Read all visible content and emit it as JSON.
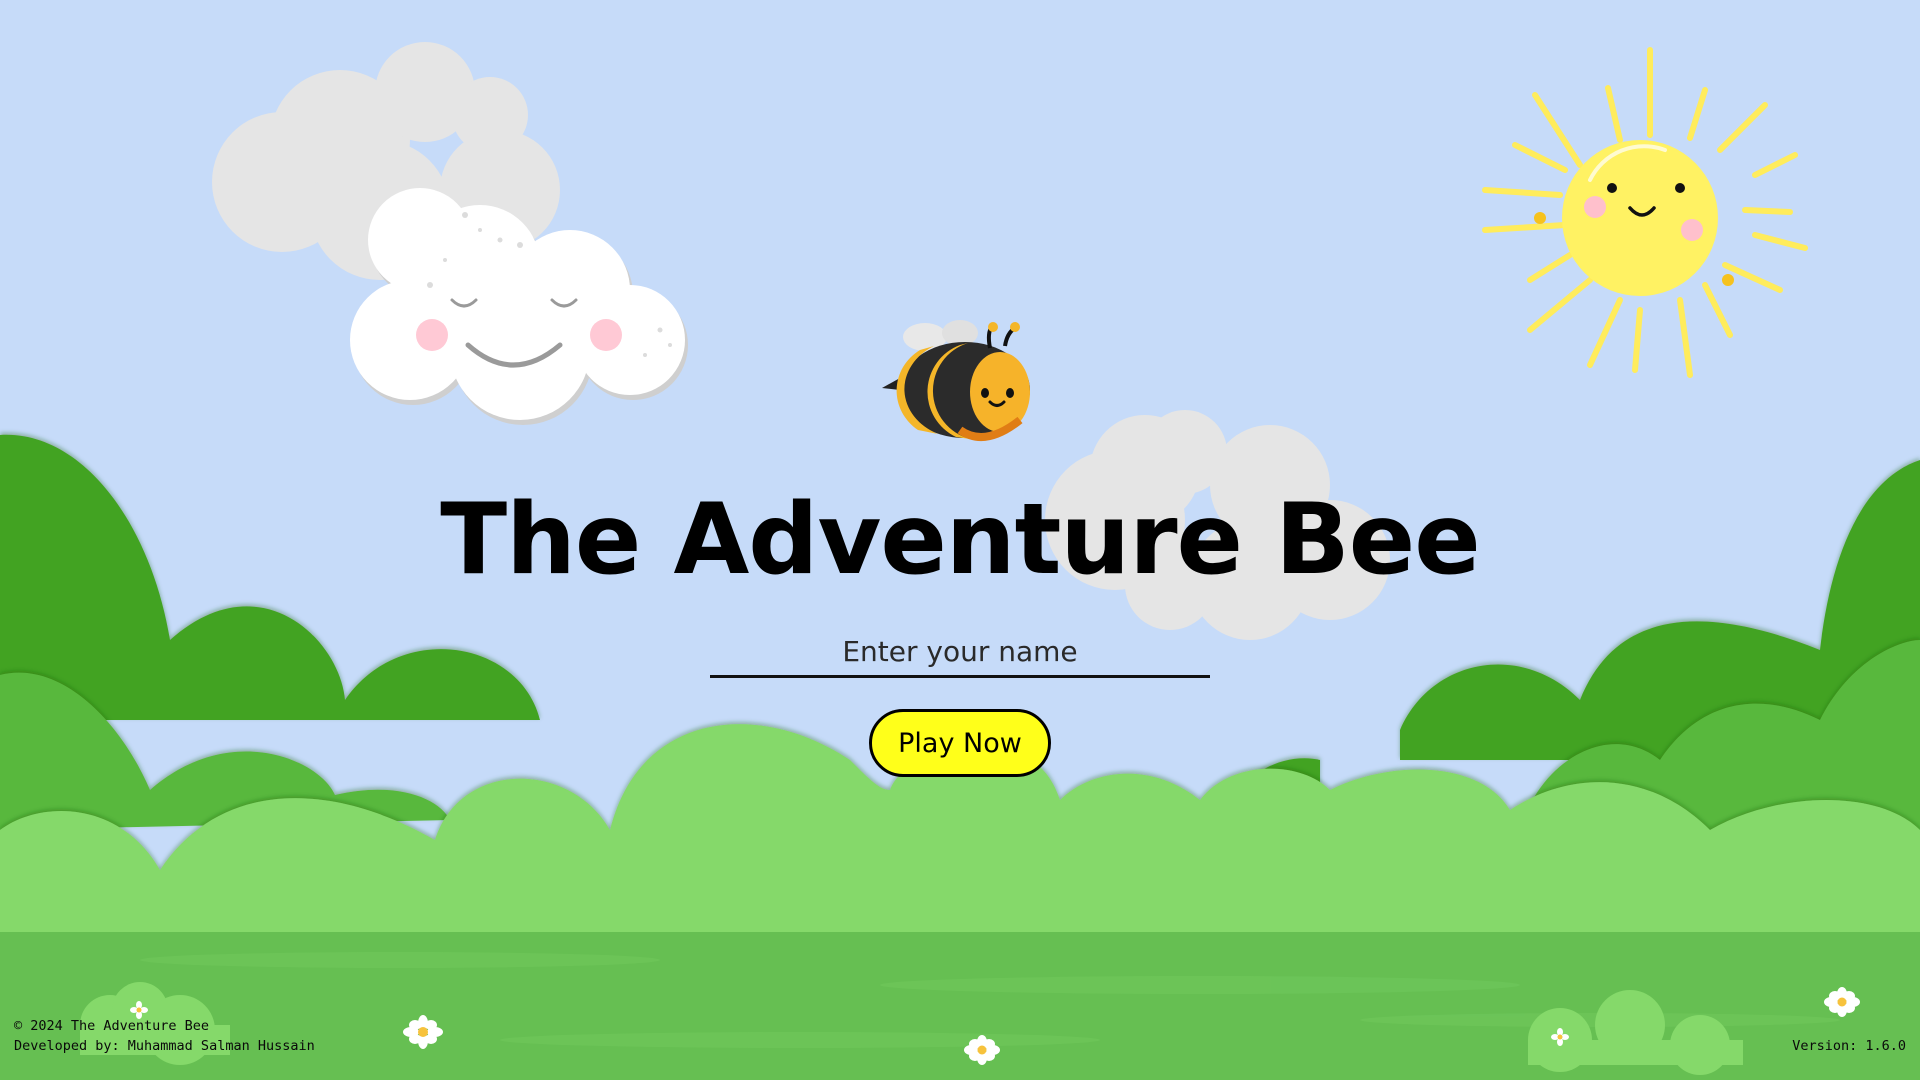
{
  "game": {
    "title": "The Adventure Bee"
  },
  "form": {
    "name_placeholder": "Enter your name",
    "name_value": "",
    "play_label": "Play Now"
  },
  "footer": {
    "copyright": "© 2024 The Adventure Bee",
    "developer": "Developed by: Muhammad Salman Hussain",
    "version": "Version: 1.6.0"
  },
  "colors": {
    "sky": "#c6dbf9",
    "hill_dark": "#43a324",
    "hill_mid": "#59b83e",
    "hill_light": "#85d96a",
    "grass": "#66bf52",
    "button": "#ffff1a",
    "sun": "#fff263"
  }
}
